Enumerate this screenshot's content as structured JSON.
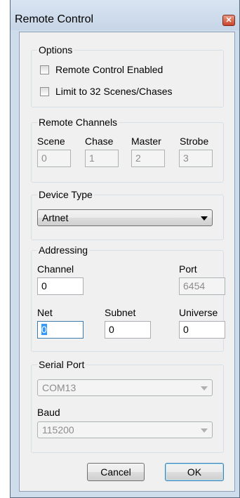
{
  "window": {
    "title": "Remote Control",
    "close_glyph": "✕"
  },
  "options": {
    "title": "Options",
    "remote_enabled_label": "Remote Control Enabled",
    "remote_enabled_checked": false,
    "limit_label": "Limit to 32 Scenes/Chases",
    "limit_checked": false
  },
  "channels": {
    "title": "Remote Channels",
    "scene_label": "Scene",
    "scene_value": "0",
    "chase_label": "Chase",
    "chase_value": "1",
    "master_label": "Master",
    "master_value": "2",
    "strobe_label": "Strobe",
    "strobe_value": "3"
  },
  "device": {
    "title": "Device Type",
    "selected": "Artnet"
  },
  "addressing": {
    "title": "Addressing",
    "channel_label": "Channel",
    "channel_value": "0",
    "port_label": "Port",
    "port_value": "6454",
    "net_label": "Net",
    "net_value": "0",
    "subnet_label": "Subnet",
    "subnet_value": "0",
    "universe_label": "Universe",
    "universe_value": "0"
  },
  "serial": {
    "title": "Serial Port",
    "port_selected": "COM13",
    "baud_label": "Baud",
    "baud_selected": "115200"
  },
  "buttons": {
    "cancel": "Cancel",
    "ok": "OK"
  },
  "colors": {
    "frame": "#cfdceb",
    "close": "#c9442a",
    "accent": "#3399ff"
  }
}
